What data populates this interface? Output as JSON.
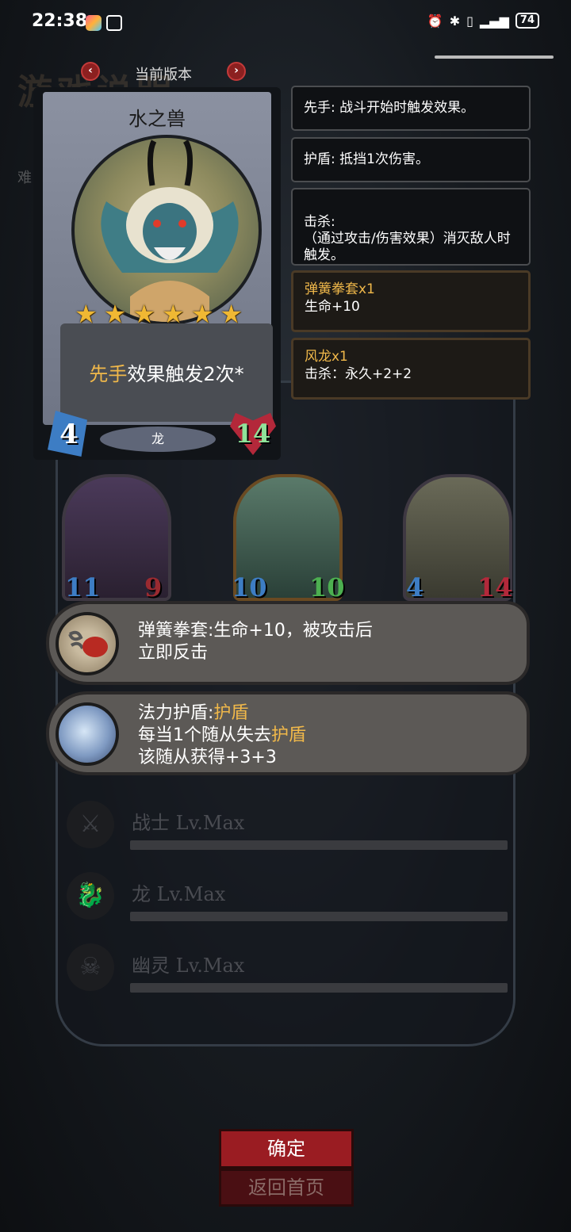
{
  "status_bar": {
    "time": "22:38",
    "battery": "74"
  },
  "background": {
    "title": "游戏说明",
    "difficulty_label": "难"
  },
  "version": {
    "label": "当前版本"
  },
  "card": {
    "name": "水之兽",
    "stars": 6,
    "effect_keyword": "先手",
    "effect_rest": "效果触发2次*",
    "attack": "4",
    "health": "14",
    "tribe": "龙"
  },
  "keywords": [
    {
      "text": "先手: 战斗开始时触发效果。"
    },
    {
      "text": "护盾: 抵挡1次伤害。"
    },
    {
      "text": "击杀:\n（通过攻击/伤害效果）消灭敌人时触发。"
    }
  ],
  "buffs": [
    {
      "title": "弹簧拳套x1",
      "desc": "生命+10"
    },
    {
      "title": "风龙x1",
      "desc": "击杀：永久+2+2"
    }
  ],
  "minions": [
    {
      "attack": "11",
      "health": "9"
    },
    {
      "attack": "10",
      "health": "10"
    },
    {
      "attack": "4",
      "health": "14"
    }
  ],
  "items": [
    {
      "line1": "弹簧拳套:生命+10，被攻击后",
      "line2": "立即反击"
    },
    {
      "name": "法力护盾:",
      "name_kw": "护盾",
      "line2a": "每当1个随从失去",
      "line2_kw": "护盾",
      "line3": "该随从获得+3+3"
    }
  ],
  "classes": [
    {
      "label": "战士 Lv.Max",
      "icon": "sword-icon"
    },
    {
      "label": "龙 Lv.Max",
      "icon": "dragon-icon"
    },
    {
      "label": "幽灵 Lv.Max",
      "icon": "ghost-icon"
    }
  ],
  "buttons": {
    "confirm": "确定",
    "home": "返回首页"
  }
}
